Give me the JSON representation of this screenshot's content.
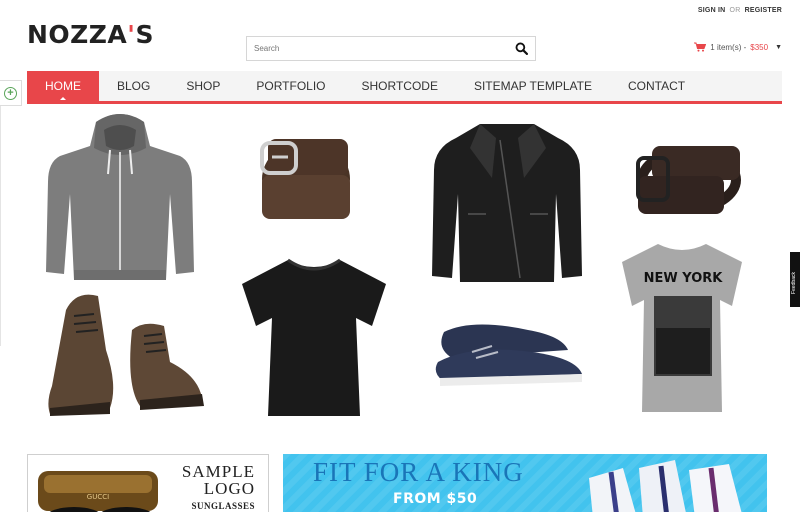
{
  "header": {
    "logo_main": "NOZZA",
    "logo_apostrophe": "'",
    "logo_end": "S",
    "sign_in": "SIGN IN",
    "or": "OR",
    "register": "REGISTER"
  },
  "search": {
    "placeholder": "Search"
  },
  "cart": {
    "items_text": "1 item(s) -",
    "price": "$350"
  },
  "nav": {
    "items": [
      {
        "label": "HOME"
      },
      {
        "label": "BLOG"
      },
      {
        "label": "SHOP"
      },
      {
        "label": "PORTFOLIO"
      },
      {
        "label": "SHORTCODE"
      },
      {
        "label": "SITEMAP TEMPLATE"
      },
      {
        "label": "CONTACT"
      }
    ],
    "active_index": 0
  },
  "products": {
    "hoodie": {
      "name": "grey-hoodie"
    },
    "belt1": {
      "name": "brown-belt"
    },
    "jacket": {
      "name": "black-leather-jacket"
    },
    "belt2": {
      "name": "dark-belt"
    },
    "boots": {
      "name": "brown-boots"
    },
    "tshirt_black": {
      "name": "black-tshirt"
    },
    "loafers": {
      "name": "navy-boat-shoes"
    },
    "tshirt_ny": {
      "name": "new-york-tshirt",
      "print_text": "NEW YORK"
    }
  },
  "banners": {
    "sample_logo": {
      "line1": "SAMPLE",
      "line2": "LOGO",
      "line3": "SUNGLASSES",
      "brand": "GUCCI"
    },
    "fit_for_king": {
      "headline": "FIT FOR A KING",
      "subline": "FROM $50"
    }
  },
  "feedback_tab": {
    "label": "Feedback"
  },
  "colors": {
    "accent": "#e8464a",
    "nav_bg": "#f4f4f4",
    "banner_blue": "#42c3ee",
    "banner_text_blue": "#1a75b8"
  }
}
